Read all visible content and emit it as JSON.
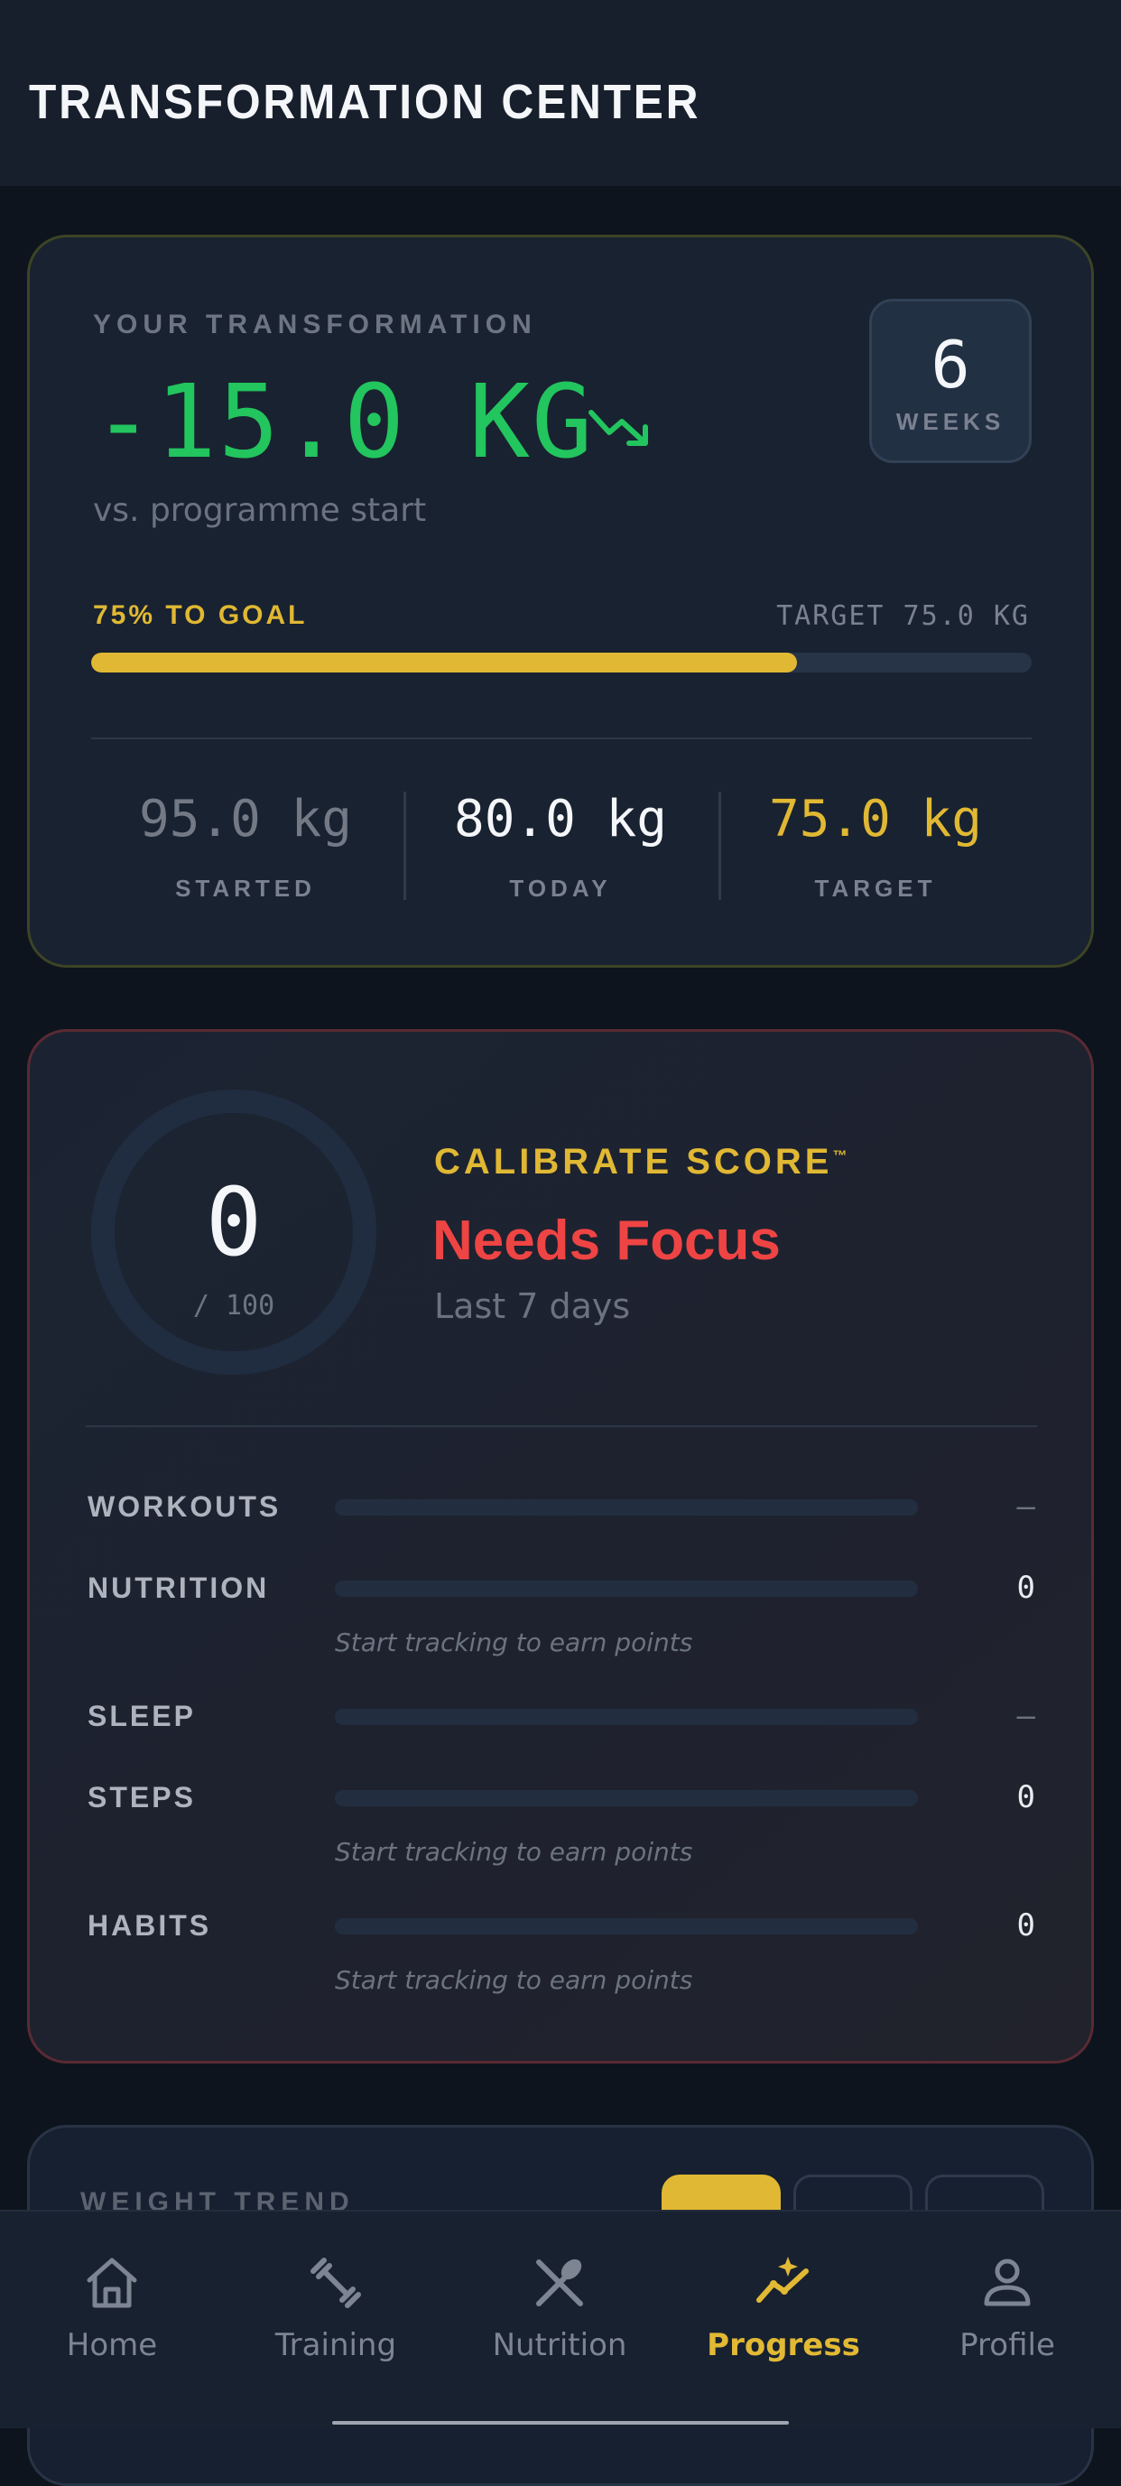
{
  "header": {
    "title": "TRANSFORMATION CENTER"
  },
  "transformation": {
    "label": "YOUR TRANSFORMATION",
    "change": "-15.0 KG",
    "subtitle": "vs. programme start",
    "weeks_value": "6",
    "weeks_label": "WEEKS",
    "goal_progress_label": "75% TO GOAL",
    "goal_progress_fraction": 0.75,
    "target_label": "TARGET 75.0 KG",
    "stats": [
      {
        "value": "95.0 kg",
        "label": "STARTED"
      },
      {
        "value": "80.0 kg",
        "label": "TODAY"
      },
      {
        "value": "75.0 kg",
        "label": "TARGET"
      }
    ],
    "colors": {
      "change": "#22c55e",
      "accent": "#e0b833"
    }
  },
  "score": {
    "value": "0",
    "max": "/ 100",
    "title": "CALIBRATE SCORE",
    "trademark": "™",
    "status": "Needs Focus",
    "period": "Last 7 days",
    "status_color": "#ef4444",
    "metrics": [
      {
        "name": "WORKOUTS",
        "value": "—",
        "hint": ""
      },
      {
        "name": "NUTRITION",
        "value": "0",
        "hint": "Start tracking to earn points"
      },
      {
        "name": "SLEEP",
        "value": "—",
        "hint": ""
      },
      {
        "name": "STEPS",
        "value": "0",
        "hint": "Start tracking to earn points"
      },
      {
        "name": "HABITS",
        "value": "0",
        "hint": "Start tracking to earn points"
      }
    ]
  },
  "trend": {
    "title": "WEIGHT TREND"
  },
  "nav": {
    "items": [
      {
        "label": "Home",
        "icon": "home-icon",
        "active": false
      },
      {
        "label": "Training",
        "icon": "dumbbell-icon",
        "active": false
      },
      {
        "label": "Nutrition",
        "icon": "utensils-icon",
        "active": false
      },
      {
        "label": "Progress",
        "icon": "trend-sparkle-icon",
        "active": true
      },
      {
        "label": "Profile",
        "icon": "user-icon",
        "active": false
      }
    ]
  }
}
